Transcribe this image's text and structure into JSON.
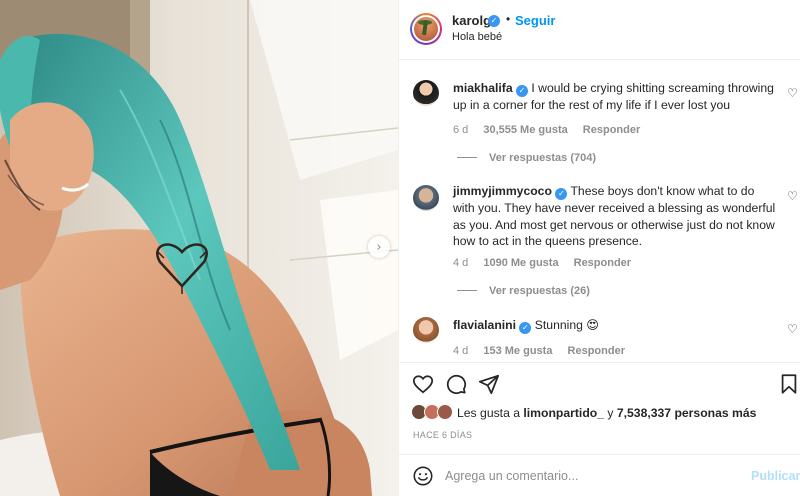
{
  "post": {
    "username": "karolg",
    "follow_label": "Seguir",
    "separator": "•",
    "subtitle": "Hola bebé",
    "verified_glyph": "✓",
    "carousel_next_glyph": "›"
  },
  "comments": [
    {
      "username": "miakhalifa",
      "text": "I would be crying shitting screaming throwing up in a corner for the rest of my life if I ever lost you",
      "time": "6 d",
      "likes": "30,555 Me gusta",
      "reply_label": "Responder",
      "view_replies": "Ver respuestas (704)"
    },
    {
      "username": "jimmyjimmycoco",
      "text": "These boys don't know what to do with you. They have never received a blessing as wonderful as you. And most get nervous or otherwise just do not know how to act in the queens presence.",
      "time": "4 d",
      "likes": "1090 Me gusta",
      "reply_label": "Responder",
      "view_replies": "Ver respuestas (26)"
    },
    {
      "username": "flavialanini",
      "text": "Stunning 😍",
      "time": "4 d",
      "likes": "153 Me gusta",
      "reply_label": "Responder"
    }
  ],
  "likes": {
    "prefix": "Les gusta a",
    "user": "limonpartido_",
    "connector": "y",
    "count": "7,538,337 personas más"
  },
  "date": "HACE 6 DÍAS",
  "composer": {
    "placeholder": "Agrega un comentario...",
    "publish_label": "Publicar"
  },
  "icons": {
    "comment_like": "heart-outline-icon",
    "post_like": "heart-icon",
    "comment": "comment-bubble-icon",
    "share": "paper-plane-icon",
    "save": "bookmark-icon",
    "emoji": "emoji-smiley-icon",
    "carousel_next": "chevron-right-icon"
  },
  "colors": {
    "accent": "#0095f6",
    "verified": "#3897f0",
    "publish_disabled": "#b2dffc",
    "muted": "#8e8e8e",
    "hair": "#4fc3b8"
  }
}
